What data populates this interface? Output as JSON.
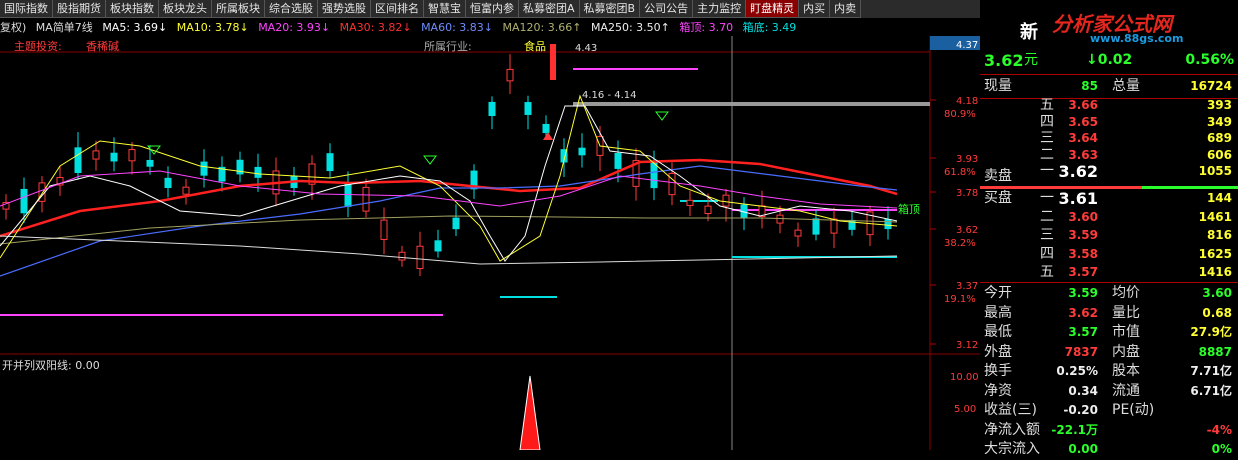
{
  "tabs": [
    "国际指数",
    "股指期货",
    "板块指数",
    "板块龙头",
    "所属板块",
    "综合选股",
    "强势选股",
    "区间排名",
    "智慧宝",
    "恒富内参",
    "私募密团A",
    "私募密团B",
    "公司公告",
    "主力监控",
    "盯盘精灵",
    "内买",
    "内卖"
  ],
  "active_tab": "盯盘精灵",
  "ma_row": {
    "prefix": "复权)",
    "indicator": "MA简单7线",
    "ma5": "MA5: 3.69↓",
    "ma10": "MA10: 3.78↓",
    "ma20": "MA20: 3.93↓",
    "ma30": "MA30: 3.82↓",
    "ma60": "MA60: 3.83↓",
    "ma120": "MA120: 3.66↑",
    "ma250": "MA250: 3.50↑",
    "box_top": "箱顶: 3.70",
    "box_bottom": "箱底: 3.49"
  },
  "chart_labels": {
    "investor": "主题投资:",
    "investor_val": "香稀碱",
    "industry": "所属行业:",
    "industry_val": "食品",
    "peak_note": "4.43",
    "range_note": "4.16 - 4.14",
    "box_top_tag": "箱顶",
    "sub_indicator": "开并列双阳线: 0.00"
  },
  "price_axis": [
    {
      "v": "4.37",
      "pct": ""
    },
    {
      "v": "4.18",
      "pct": "80.9%"
    },
    {
      "v": "3.93",
      "pct": "61.8%"
    },
    {
      "v": "3.78",
      "pct": ""
    },
    {
      "v": "3.62",
      "pct": "38.2%"
    },
    {
      "v": "3.37",
      "pct": "19.1%"
    },
    {
      "v": "3.12",
      "pct": ""
    }
  ],
  "sub_axis": [
    "10.00",
    "5.00"
  ],
  "colors": {
    "up": "#ff3b3b",
    "down": "#00e0e0",
    "ma5": "#ffffff",
    "ma10": "#ffff33",
    "ma20": "#ff44ff",
    "ma30": "#ff2020",
    "ma60": "#4a6cff",
    "ma120": "#a0a060",
    "ma250": "#dddddd"
  },
  "quote": {
    "name": "新",
    "price": "3.62",
    "price_unit": "元",
    "change": "↓0.02",
    "pct": "0.56%",
    "volume_now_label": "现量",
    "volume_now": "85",
    "volume_total_label": "总量",
    "volume_total": "16724",
    "sell_label": "卖盘",
    "buy_label": "买盘",
    "asks": [
      {
        "n": "五",
        "p": "3.66",
        "q": "393"
      },
      {
        "n": "四",
        "p": "3.65",
        "q": "349"
      },
      {
        "n": "三",
        "p": "3.64",
        "q": "689"
      },
      {
        "n": "二",
        "p": "3.63",
        "q": "606"
      },
      {
        "n": "一",
        "p": "3.62",
        "q": "1055"
      }
    ],
    "bids": [
      {
        "n": "一",
        "p": "3.61",
        "q": "144"
      },
      {
        "n": "二",
        "p": "3.60",
        "q": "1461"
      },
      {
        "n": "三",
        "p": "3.59",
        "q": "816"
      },
      {
        "n": "四",
        "p": "3.58",
        "q": "1625"
      },
      {
        "n": "五",
        "p": "3.57",
        "q": "1416"
      }
    ],
    "stats": [
      {
        "l": "今开",
        "v": "3.59",
        "l2": "均价",
        "v2": "3.60"
      },
      {
        "l": "最高",
        "v": "3.62",
        "l2": "量比",
        "v2": "0.68"
      },
      {
        "l": "最低",
        "v": "3.57",
        "l2": "市值",
        "v2": "27.9亿"
      },
      {
        "l": "外盘",
        "v": "7837",
        "l2": "内盘",
        "v2": "8887"
      },
      {
        "l": "换手",
        "v": "0.25%",
        "l2": "股本",
        "v2": "7.71亿"
      },
      {
        "l": "净资",
        "v": "0.34",
        "l2": "流通",
        "v2": "6.71亿"
      },
      {
        "l": "收益(三)",
        "v": "-0.20",
        "l2": "PE(动)",
        "v2": ""
      },
      {
        "l": "净流入额",
        "v": "-22.1万",
        "l2": "",
        "v2": "-4%"
      },
      {
        "l": "大宗流入",
        "v": "0.00",
        "l2": "",
        "v2": "0%"
      }
    ]
  },
  "watermark": {
    "text": "分析家公式网",
    "url": "www.88gs.com"
  }
}
